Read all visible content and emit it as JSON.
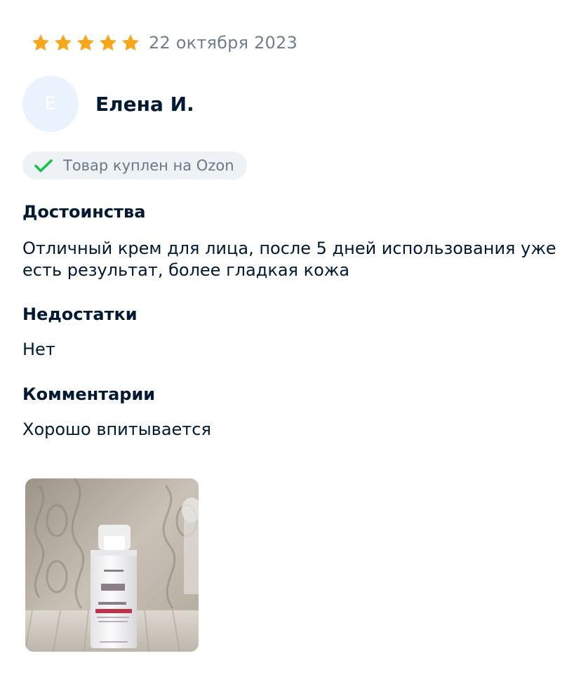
{
  "review": {
    "rating": 5,
    "rating_max": 5,
    "date": "22 октября 2023",
    "author": {
      "name": "Елена И.",
      "avatar_letter": "Е"
    },
    "verified_badge": "Товар куплен на Ozon",
    "sections": {
      "pros": {
        "title": "Достоинства",
        "text": "Отличный крем для лица, после 5 дней использования уже есть результат, более гладкая кожа"
      },
      "cons": {
        "title": "Недостатки",
        "text": "Нет"
      },
      "comments": {
        "title": "Комментарии",
        "text": "Хорошо впитывается"
      }
    },
    "photo": {
      "icon": "product-photo"
    }
  },
  "colors": {
    "star": "#f9a61b",
    "check": "#10c44c",
    "avatar_bg": "#eaf3fd",
    "badge_bg": "#eff2f5",
    "muted_text": "#707f8d",
    "main_text": "#001a34"
  }
}
